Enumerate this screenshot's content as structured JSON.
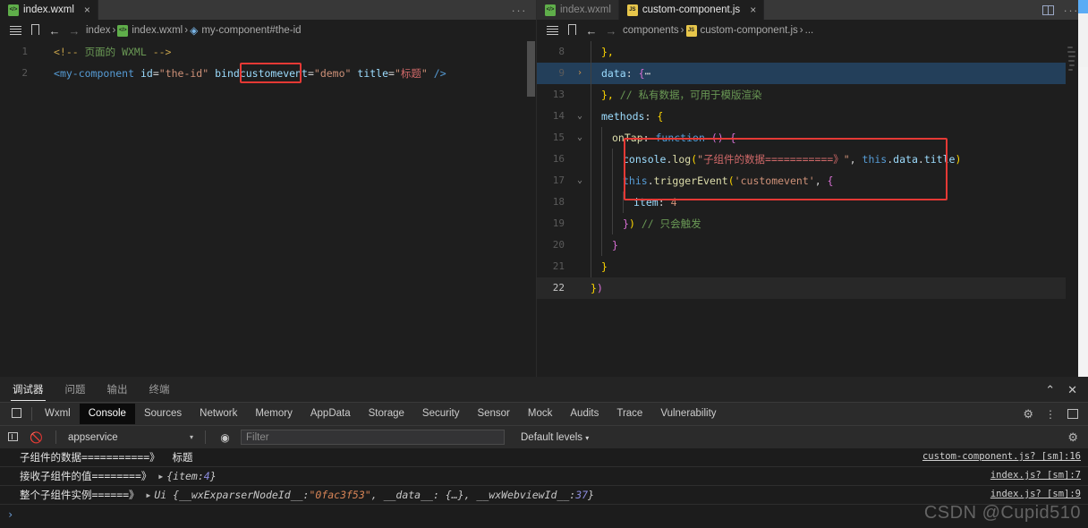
{
  "left_pane": {
    "tab": {
      "label": "index.wxml",
      "icon": "wxml-file-icon",
      "close": "×"
    },
    "tab_actions": {
      "more": "···"
    },
    "breadcrumb": {
      "icons": [
        "outline-list-icon",
        "bookmark-icon",
        "arrow-left-icon",
        "arrow-right-icon"
      ],
      "items": [
        "index",
        "index.wxml",
        "my-component#the-id"
      ],
      "separator": "›"
    },
    "code": {
      "lines": [
        {
          "num": "1",
          "fold": "",
          "tokens": [
            {
              "t": "<!--",
              "c": "t-com2"
            },
            {
              "t": " ",
              "c": "t-plain"
            },
            {
              "t": "页面的 WXML",
              "c": "t-com"
            },
            {
              "t": " ",
              "c": "t-plain"
            },
            {
              "t": "-->",
              "c": "t-com2"
            }
          ]
        },
        {
          "num": "2",
          "fold": "",
          "tokens": [
            {
              "t": "<",
              "c": "t-tag"
            },
            {
              "t": "my-component",
              "c": "t-tag"
            },
            {
              "t": " ",
              "c": "t-plain"
            },
            {
              "t": "id",
              "c": "t-attr"
            },
            {
              "t": "=",
              "c": "t-plain"
            },
            {
              "t": "\"the-id\"",
              "c": "t-str"
            },
            {
              "t": " ",
              "c": "t-plain"
            },
            {
              "t": "bind",
              "c": "t-attr"
            },
            {
              "t": "customevent",
              "c": "t-attr"
            },
            {
              "t": "=",
              "c": "t-plain"
            },
            {
              "t": "\"demo\"",
              "c": "t-str"
            },
            {
              "t": " ",
              "c": "t-plain"
            },
            {
              "t": "title",
              "c": "t-attr"
            },
            {
              "t": "=",
              "c": "t-plain"
            },
            {
              "t": "\"",
              "c": "t-str"
            },
            {
              "t": "标题",
              "c": "t-red"
            },
            {
              "t": "\"",
              "c": "t-str"
            },
            {
              "t": " ",
              "c": "t-plain"
            },
            {
              "t": "/>",
              "c": "t-tag"
            }
          ]
        }
      ]
    }
  },
  "right_pane": {
    "tabs": [
      {
        "label": "index.wxml",
        "icon": "wxml-file-icon",
        "active": false,
        "close": ""
      },
      {
        "label": "custom-component.js",
        "icon": "js-file-icon",
        "active": true,
        "close": "×"
      }
    ],
    "tab_actions": {
      "split": "split-editor-icon",
      "more": "···"
    },
    "breadcrumb": {
      "icons": [
        "outline-list-icon",
        "bookmark-icon",
        "arrow-left-icon",
        "arrow-right-icon"
      ],
      "items": [
        "components",
        "custom-component.js",
        "..."
      ],
      "separator": "›"
    },
    "code": {
      "lines": [
        {
          "num": "8",
          "fold": "",
          "indent": 1,
          "hl": "",
          "tokens": [
            {
              "t": "},",
              "c": "t-br1"
            }
          ]
        },
        {
          "num": "9",
          "fold": "closed",
          "indent": 1,
          "hl": "sel",
          "tokens": [
            {
              "t": "data",
              "c": "t-prop"
            },
            {
              "t": ": ",
              "c": "t-plain"
            },
            {
              "t": "{",
              "c": "t-br2"
            },
            {
              "t": "⋯",
              "c": "t-plain"
            }
          ]
        },
        {
          "num": "13",
          "fold": "",
          "indent": 1,
          "hl": "",
          "tokens": [
            {
              "t": "}, ",
              "c": "t-br1"
            },
            {
              "t": "// 私有数据，可用于模版渲染",
              "c": "t-com"
            }
          ]
        },
        {
          "num": "14",
          "fold": "open",
          "indent": 1,
          "hl": "",
          "tokens": [
            {
              "t": "methods",
              "c": "t-prop"
            },
            {
              "t": ": ",
              "c": "t-plain"
            },
            {
              "t": "{",
              "c": "t-br1"
            }
          ]
        },
        {
          "num": "15",
          "fold": "open",
          "indent": 2,
          "hl": "",
          "tokens": [
            {
              "t": "onTap",
              "c": "t-fn"
            },
            {
              "t": ": ",
              "c": "t-plain"
            },
            {
              "t": "function",
              "c": "t-kw"
            },
            {
              "t": " ",
              "c": "t-plain"
            },
            {
              "t": "()",
              "c": "t-br2"
            },
            {
              "t": " ",
              "c": "t-plain"
            },
            {
              "t": "{",
              "c": "t-br2"
            }
          ]
        },
        {
          "num": "16",
          "fold": "",
          "indent": 3,
          "hl": "",
          "tokens": [
            {
              "t": "console",
              "c": "t-prop"
            },
            {
              "t": ".",
              "c": "t-plain"
            },
            {
              "t": "log",
              "c": "t-fn"
            },
            {
              "t": "(",
              "c": "t-br1"
            },
            {
              "t": "\"",
              "c": "t-str"
            },
            {
              "t": "子组件的数据===========》",
              "c": "t-red"
            },
            {
              "t": "\"",
              "c": "t-str"
            },
            {
              "t": ", ",
              "c": "t-plain"
            },
            {
              "t": "this",
              "c": "t-kw"
            },
            {
              "t": ".",
              "c": "t-plain"
            },
            {
              "t": "data",
              "c": "t-prop"
            },
            {
              "t": ".",
              "c": "t-plain"
            },
            {
              "t": "title",
              "c": "t-prop"
            },
            {
              "t": ")",
              "c": "t-br1"
            }
          ]
        },
        {
          "num": "17",
          "fold": "open",
          "indent": 3,
          "hl": "",
          "tokens": [
            {
              "t": "this",
              "c": "t-kw"
            },
            {
              "t": ".",
              "c": "t-plain"
            },
            {
              "t": "triggerEvent",
              "c": "t-fn"
            },
            {
              "t": "(",
              "c": "t-br1"
            },
            {
              "t": "'customevent'",
              "c": "t-str"
            },
            {
              "t": ", ",
              "c": "t-plain"
            },
            {
              "t": "{",
              "c": "t-br2"
            }
          ]
        },
        {
          "num": "18",
          "fold": "",
          "indent": 4,
          "hl": "",
          "tokens": [
            {
              "t": "item",
              "c": "t-prop"
            },
            {
              "t": ": ",
              "c": "t-plain"
            },
            {
              "t": "4",
              "c": "t-str"
            }
          ]
        },
        {
          "num": "19",
          "fold": "",
          "indent": 3,
          "hl": "",
          "tokens": [
            {
              "t": "}",
              "c": "t-br2"
            },
            {
              "t": ")",
              "c": "t-br1"
            },
            {
              "t": " ",
              "c": "t-plain"
            },
            {
              "t": "// 只会触发",
              "c": "t-com"
            }
          ]
        },
        {
          "num": "20",
          "fold": "",
          "indent": 2,
          "hl": "",
          "tokens": [
            {
              "t": "}",
              "c": "t-br2"
            }
          ]
        },
        {
          "num": "21",
          "fold": "",
          "indent": 1,
          "hl": "",
          "tokens": [
            {
              "t": "}",
              "c": "t-br1"
            }
          ]
        },
        {
          "num": "22",
          "fold": "",
          "indent": 0,
          "hl": "cur",
          "tokens": [
            {
              "t": "}",
              "c": "t-br1"
            },
            {
              "t": ")",
              "c": "t-br2"
            }
          ]
        }
      ]
    }
  },
  "debugger": {
    "panel_tabs": [
      {
        "label": "调试器",
        "active": true
      },
      {
        "label": "问题",
        "active": false
      },
      {
        "label": "输出",
        "active": false
      },
      {
        "label": "终端",
        "active": false
      }
    ],
    "panel_actions": {
      "collapse": "⌃",
      "close": "✕"
    },
    "devtools_tabs": [
      {
        "label": "Wxml",
        "active": false
      },
      {
        "label": "Console",
        "active": true
      },
      {
        "label": "Sources",
        "active": false
      },
      {
        "label": "Network",
        "active": false
      },
      {
        "label": "Memory",
        "active": false
      },
      {
        "label": "AppData",
        "active": false
      },
      {
        "label": "Storage",
        "active": false
      },
      {
        "label": "Security",
        "active": false
      },
      {
        "label": "Sensor",
        "active": false
      },
      {
        "label": "Mock",
        "active": false
      },
      {
        "label": "Audits",
        "active": false
      },
      {
        "label": "Trace",
        "active": false
      },
      {
        "label": "Vulnerability",
        "active": false
      }
    ],
    "devtools_icons": {
      "inspect": "inspect-element-icon",
      "settings": "gear-icon",
      "more": "more-vertical-icon",
      "dock": "dock-panel-icon"
    },
    "console_toolbar": {
      "execute_icon": "sidebar-toggle-icon",
      "clear_icon": "clear-console-icon",
      "context": "appservice",
      "context_arrow": "▾",
      "eye_icon": "live-expression-icon",
      "filter_placeholder": "Filter",
      "filter_value": "",
      "levels": "Default levels",
      "levels_arrow": "▾",
      "settings_icon": "gear-icon"
    },
    "console_rows": [
      {
        "message": "子组件的数据===========》  标题",
        "link": "custom-component.js? [sm]:16",
        "expandable": false
      },
      {
        "message": "接收子组件的值========》",
        "link": "index.js? [sm]:7",
        "expandable": true,
        "object_parts": [
          {
            "t": "{item: ",
            "c": "obj"
          },
          {
            "t": "4",
            "c": "onum"
          },
          {
            "t": "}",
            "c": "obj"
          }
        ]
      },
      {
        "message": "整个子组件实例======》",
        "link": "index.js? [sm]:9",
        "expandable": true,
        "object_parts": [
          {
            "t": "Ui {__wxExparserNodeId__: ",
            "c": "obj"
          },
          {
            "t": "\"0fac3f53\"",
            "c": "ostr"
          },
          {
            "t": ", __data__: {…}, __wxWebviewId__: ",
            "c": "obj"
          },
          {
            "t": "37",
            "c": "onum"
          },
          {
            "t": "}",
            "c": "obj"
          }
        ]
      }
    ],
    "prompt": "›",
    "watermark": "CSDN @Cupid510"
  },
  "colors": {
    "accent_red": "#e53935",
    "editor_bg": "#1e1e1e",
    "tabbar_bg": "#323233",
    "panel_bg": "#242424"
  }
}
